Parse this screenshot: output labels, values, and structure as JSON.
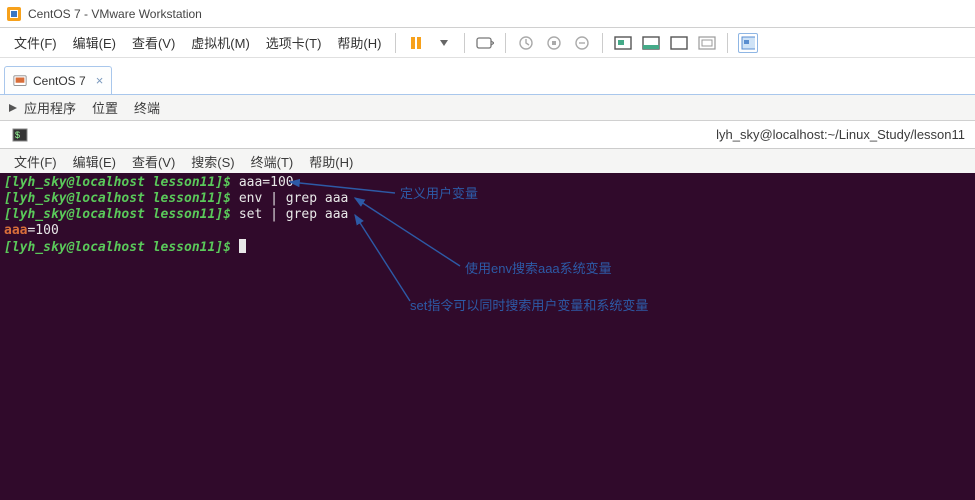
{
  "window": {
    "title": "CentOS 7 - VMware Workstation"
  },
  "menubar": {
    "file": "文件(F)",
    "edit": "编辑(E)",
    "view": "查看(V)",
    "vm": "虚拟机(M)",
    "tabs": "选项卡(T)",
    "help": "帮助(H)"
  },
  "tab": {
    "label": "CentOS 7",
    "close": "×"
  },
  "gnome": {
    "applications": "应用程序",
    "places": "位置",
    "terminal_app": "终端"
  },
  "pathbar": {
    "title": "lyh_sky@localhost:~/Linux_Study/lesson11"
  },
  "term_menu": {
    "file": "文件(F)",
    "edit": "编辑(E)",
    "view": "查看(V)",
    "search": "搜索(S)",
    "terminal": "终端(T)",
    "help": "帮助(H)"
  },
  "terminal": {
    "prompt1": "[lyh_sky@localhost lesson11]$ ",
    "cmd1": "aaa=100",
    "prompt2": "[lyh_sky@localhost lesson11]$ ",
    "cmd2": "env | grep aaa",
    "prompt3": "[lyh_sky@localhost lesson11]$ ",
    "cmd3": "set | grep aaa",
    "out_key": "aaa",
    "out_eq": "=100",
    "prompt4": "[lyh_sky@localhost lesson11]$ "
  },
  "annotations": {
    "a1": "定义用户变量",
    "a2": "使用env搜索aaa系统变量",
    "a3": "set指令可以同时搜索用户变量和系统变量"
  }
}
